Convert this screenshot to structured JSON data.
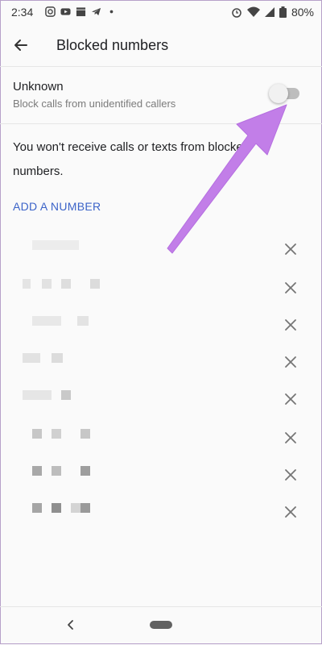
{
  "status_bar": {
    "time": "2:34",
    "left_icons": [
      "instagram-icon",
      "youtube-icon",
      "clapperboard-icon",
      "telegram-icon",
      "dot-icon"
    ],
    "right_icons": [
      "alarm-icon",
      "wifi-icon",
      "signal-icon",
      "battery-icon"
    ],
    "battery": "80%"
  },
  "app_bar": {
    "title": "Blocked numbers",
    "back_icon": "arrow-back-icon"
  },
  "unknown_setting": {
    "title": "Unknown",
    "subtitle": "Block calls from unidentified callers",
    "enabled": false
  },
  "info_text": "You won't receive calls or texts from blocked numbers.",
  "add_number_label": "ADD A NUMBER",
  "blocked_rows_count": 8,
  "overlay": {
    "arrow_color": "#c27ee8"
  },
  "nav": {
    "back_icon": "nav-back-icon",
    "home_icon": "home-pill-icon"
  }
}
